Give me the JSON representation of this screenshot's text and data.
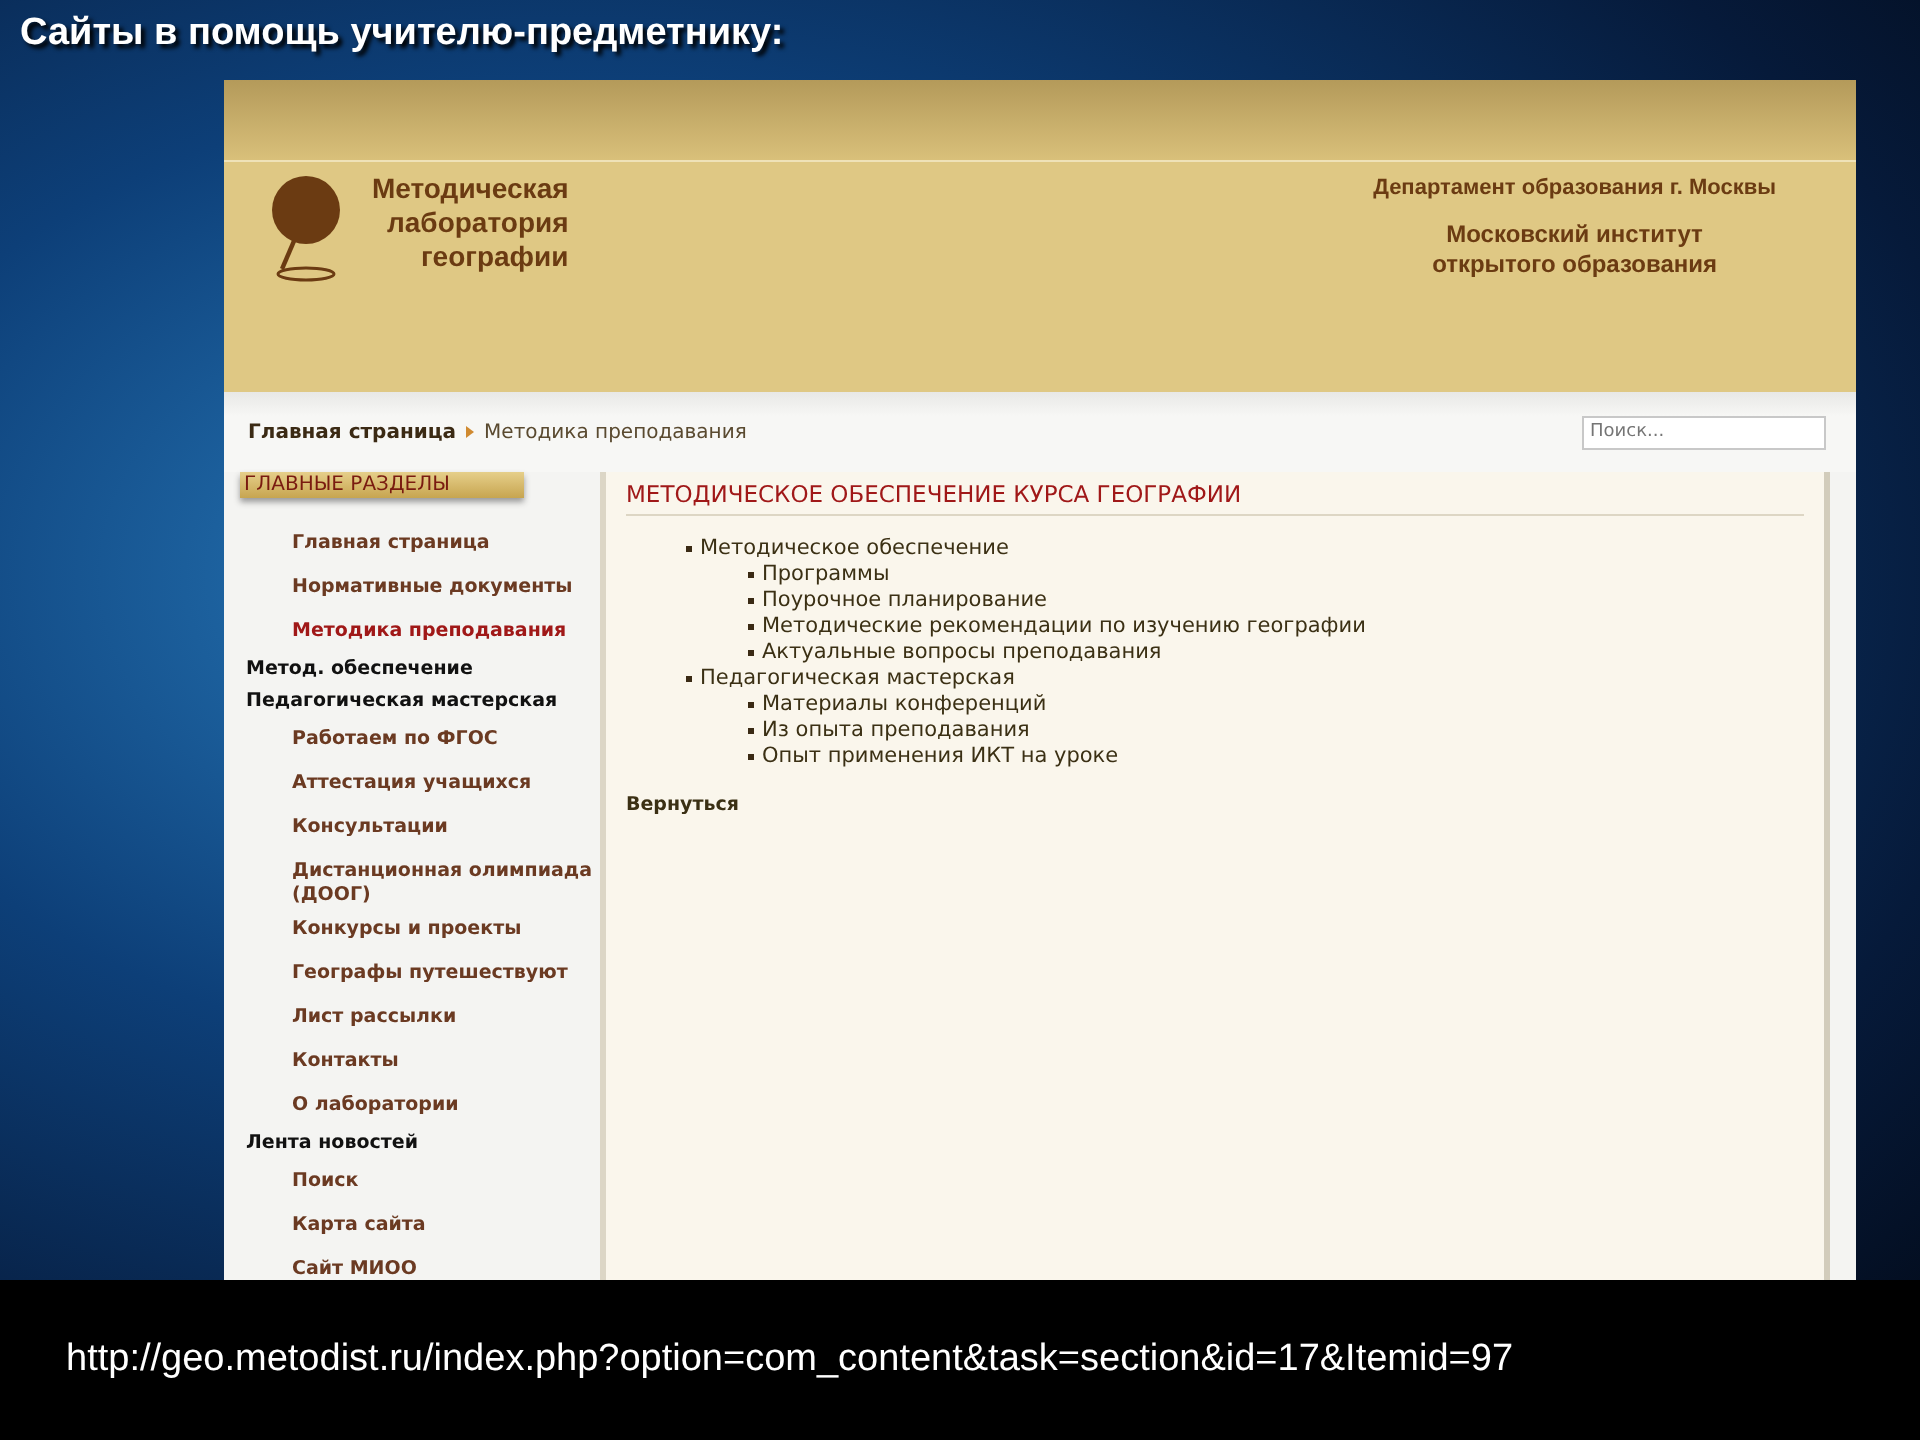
{
  "slide": {
    "title": "Сайты в помощь учителю-предметнику:",
    "url": "http://geo.metodist.ru/index.php?option=com_content&task=section&id=17&Itemid=97"
  },
  "site_header": {
    "logo_lines": [
      "Методическая",
      "лаборатория",
      "географии"
    ],
    "department": "Департамент образования г. Москвы",
    "institute_lines": [
      "Московский институт",
      "открытого образования"
    ]
  },
  "breadcrumb": [
    "Главная страница",
    "Методика преподавания"
  ],
  "search": {
    "placeholder": "Поиск..."
  },
  "sidebar": {
    "title": "ГЛАВНЫЕ РАЗДЕЛЫ",
    "items": [
      {
        "kind": "link",
        "label": "Главная страница",
        "selected": false
      },
      {
        "kind": "link",
        "label": "Нормативные документы",
        "selected": false
      },
      {
        "kind": "link",
        "label": "Методика преподавания",
        "selected": true
      },
      {
        "kind": "section",
        "label": "Метод. обеспечение",
        "selected": false
      },
      {
        "kind": "section",
        "label": "Педагогическая мастерская",
        "selected": false
      },
      {
        "kind": "link",
        "label": "Работаем по ФГОС",
        "selected": false
      },
      {
        "kind": "link",
        "label": "Аттестация учащихся",
        "selected": false
      },
      {
        "kind": "link",
        "label": "Консультации",
        "selected": false
      },
      {
        "kind": "link",
        "label": "Дистанционная олимпиада (ДООГ)",
        "selected": false
      },
      {
        "kind": "link2",
        "label": "Конкурсы и проекты",
        "selected": false
      },
      {
        "kind": "link",
        "label": "Географы путешествуют",
        "selected": false
      },
      {
        "kind": "link",
        "label": "Лист рассылки",
        "selected": false
      },
      {
        "kind": "link",
        "label": "Контакты",
        "selected": false
      },
      {
        "kind": "link",
        "label": "О лаборатории",
        "selected": false
      },
      {
        "kind": "section",
        "label": "Лента новостей",
        "selected": false
      },
      {
        "kind": "link",
        "label": "Поиск",
        "selected": false
      },
      {
        "kind": "link",
        "label": "Карта сайта",
        "selected": false
      },
      {
        "kind": "link",
        "label": "Сайт МИОО",
        "selected": false
      }
    ]
  },
  "content": {
    "title": "МЕТОДИЧЕСКОЕ ОБЕСПЕЧЕНИЕ КУРСА ГЕОГРАФИИ",
    "items": [
      {
        "label": "Методическое обеспечение",
        "children": [
          {
            "label": "Программы"
          },
          {
            "label": "Поурочное планирование"
          },
          {
            "label": "Методические рекомендации по изучению географии"
          },
          {
            "label": "Актуальные вопросы преподавания"
          }
        ]
      },
      {
        "label": "Педагогическая мастерская",
        "children": [
          {
            "label": "Материалы конференций"
          },
          {
            "label": "Из опыта преподавания"
          },
          {
            "label": "Опыт применения ИКТ на уроке"
          }
        ]
      }
    ],
    "back_link": "Вернуться"
  }
}
